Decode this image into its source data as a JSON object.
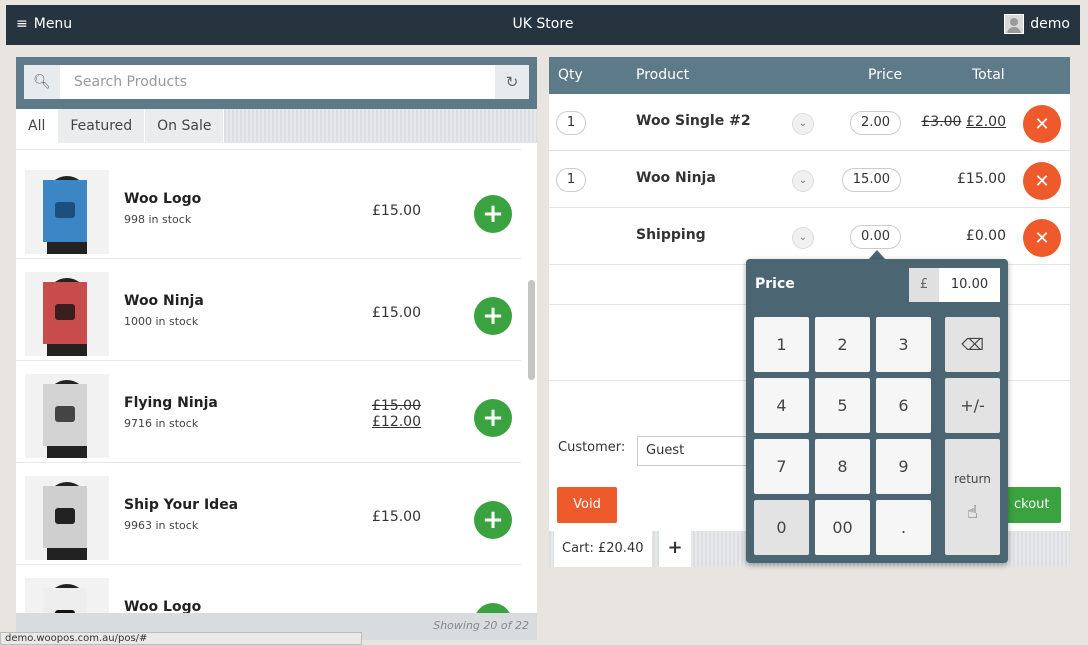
{
  "topbar": {
    "menu_label": "Menu",
    "store_title": "UK Store",
    "user_name": "demo"
  },
  "products": {
    "search_placeholder": "Search Products",
    "tabs": [
      "All",
      "Featured",
      "On Sale"
    ],
    "items": [
      {
        "name": "Woo Logo",
        "stock": "998 in stock",
        "price": "£15.00",
        "poster_color": "#3d86c6",
        "mark_color": "#1b4f7e"
      },
      {
        "name": "Woo Ninja",
        "stock": "1000 in stock",
        "price": "£15.00",
        "poster_color": "#c94c4c",
        "mark_color": "#3b1e1e"
      },
      {
        "name": "Flying Ninja",
        "stock": "9716 in stock",
        "old_price": "£15.00",
        "price": "£12.00",
        "poster_color": "#d3d3d3",
        "mark_color": "#444444"
      },
      {
        "name": "Ship Your Idea",
        "stock": "9963 in stock",
        "price": "£15.00",
        "poster_color": "#cfcfcf",
        "mark_color": "#222222"
      },
      {
        "name": "Woo Logo",
        "stock": "",
        "price": "",
        "poster_color": "#eeeeee",
        "mark_color": "#111111"
      }
    ],
    "showing": "Showing 20 of 22"
  },
  "status_url": "demo.woopos.com.au/pos/#",
  "cart": {
    "headers": {
      "qty": "Qty",
      "product": "Product",
      "price": "Price",
      "total": "Total"
    },
    "rows": [
      {
        "qty": "1",
        "name": "Woo Single #2",
        "price": "2.00",
        "total_old": "£3.00",
        "total": "£2.00"
      },
      {
        "qty": "1",
        "name": "Woo Ninja",
        "price": "15.00",
        "total_old": "",
        "total": "£15.00"
      },
      {
        "qty": "",
        "name": "Shipping",
        "price": "0.00",
        "total_old": "",
        "total": "£0.00"
      }
    ],
    "customer_label": "Customer:",
    "customer_value": "Guest",
    "void_label": "Void",
    "checkout_label": "ckout",
    "cart_tab": "Cart: £20.40",
    "add_cart": "+"
  },
  "keypad": {
    "title": "Price",
    "currency": "£",
    "value": "10.00",
    "keys": [
      "1",
      "2",
      "3",
      "4",
      "5",
      "6",
      "7",
      "8",
      "9",
      "0",
      "00",
      "."
    ],
    "backspace": "⌫",
    "plusminus": "+/-",
    "return_label": "return"
  },
  "colors": {
    "accent_green": "#3aa33f",
    "accent_red": "#ef5a2c",
    "header_blue": "#5d7a88",
    "topbar": "#25343f"
  }
}
